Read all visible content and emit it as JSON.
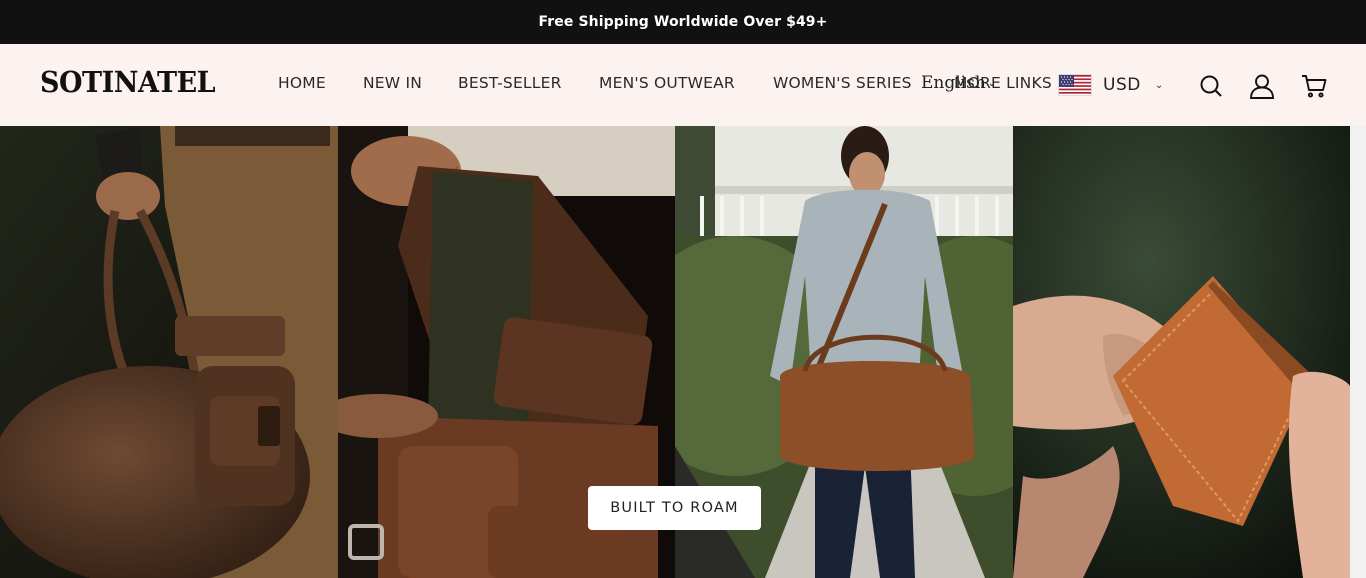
{
  "announcement": {
    "text": "Free Shipping Worldwide Over $49+"
  },
  "header": {
    "logo": "SOTINATEL",
    "nav": [
      {
        "label": "HOME"
      },
      {
        "label": "NEW IN"
      },
      {
        "label": "BEST-SELLER"
      },
      {
        "label": "MEN'S OUTWEAR"
      },
      {
        "label": "WOMEN'S SERIES"
      },
      {
        "label": "MORE LINKS"
      }
    ],
    "language": {
      "label": "English"
    },
    "currency": {
      "code": "USD",
      "flag_icon": "us-flag-icon"
    },
    "icons": [
      "search-icon",
      "account-icon",
      "cart-icon"
    ]
  },
  "hero": {
    "cta_label": "BUILT TO ROAM",
    "panels": [
      {
        "subject": "brown leather duffel bag held by man in khaki pants"
      },
      {
        "subject": "brown leather laptop messenger bag"
      },
      {
        "subject": "man carrying tan leather duffel bag walking on path"
      },
      {
        "subject": "orange leather bifold wallet held in hand"
      }
    ]
  },
  "colors": {
    "announcement_bg": "#111111",
    "header_bg": "#fcf3f1",
    "text": "#222222"
  }
}
